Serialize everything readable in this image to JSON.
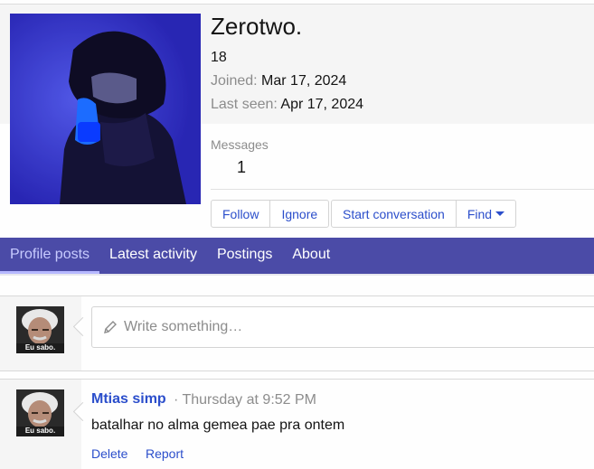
{
  "profile": {
    "username": "Zerotwo.",
    "age": "18",
    "joined_label": "Joined:",
    "joined_value": "Mar 17, 2024",
    "last_seen_label": "Last seen:",
    "last_seen_value": "Apr 17, 2024",
    "stats": {
      "messages_label": "Messages",
      "messages_value": "1"
    }
  },
  "actions": {
    "follow": "Follow",
    "ignore": "Ignore",
    "start_conversation": "Start conversation",
    "find": "Find"
  },
  "tabs": [
    {
      "label": "Profile posts",
      "active": true
    },
    {
      "label": "Latest activity",
      "active": false
    },
    {
      "label": "Postings",
      "active": false
    },
    {
      "label": "About",
      "active": false
    }
  ],
  "composer": {
    "placeholder": "Write something…",
    "avatar_caption": "Eu sabo."
  },
  "posts": [
    {
      "author": "Mtias simp",
      "time": "· Thursday at 9:52 PM",
      "body": "batalhar no alma gemea pae pra ontem",
      "avatar_caption": "Eu sabo.",
      "actions": [
        "Delete",
        "Report"
      ]
    }
  ],
  "colors": {
    "tab_bar": "#4b4ba7",
    "link": "#2b4ecb",
    "muted": "#8c8c8c"
  },
  "icons": [
    "pencil-icon",
    "chevron-down-icon"
  ]
}
